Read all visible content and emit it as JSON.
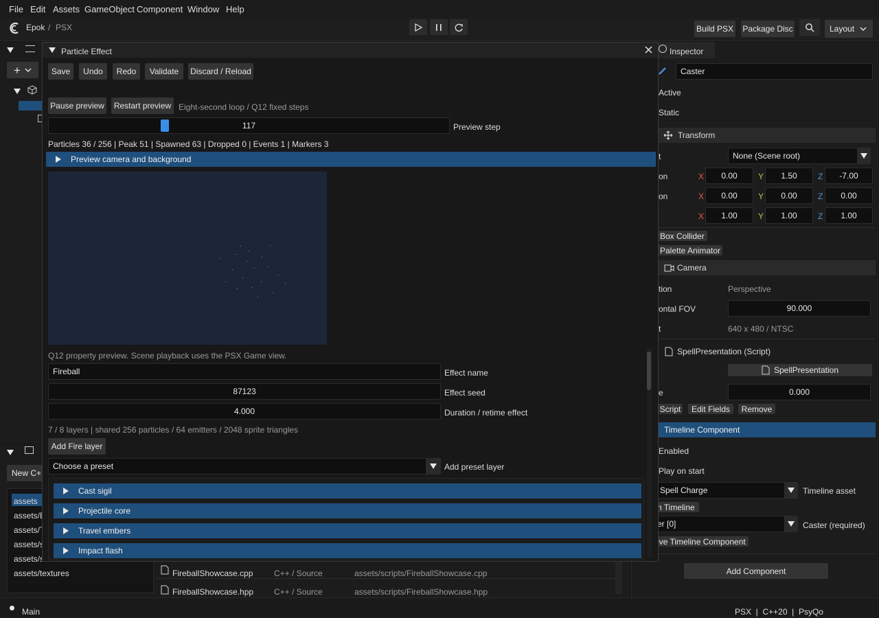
{
  "menu": [
    "File",
    "Edit",
    "Assets",
    "GameObject",
    "Component",
    "Window",
    "Help"
  ],
  "breadcrumb": {
    "project": "Epok",
    "separator": "/",
    "target": "PSX"
  },
  "toolbar": {
    "build": "Build PSX",
    "package": "Package Disc",
    "layout": "Layout"
  },
  "inspector": {
    "title": "Inspector",
    "object_name": "Caster",
    "active_label": "Active",
    "static_label": "Static",
    "transform": {
      "title": "Transform",
      "parent_row_label": "t",
      "parent_value": "None (Scene root)",
      "rows": [
        {
          "label": "on",
          "x": "0.00",
          "y": "1.50",
          "z": "-7.00"
        },
        {
          "label": "on",
          "x": "0.00",
          "y": "0.00",
          "z": "0.00"
        },
        {
          "label": "",
          "x": "1.00",
          "y": "1.00",
          "z": "1.00"
        }
      ],
      "axis_x": "X",
      "axis_y": "Y",
      "axis_z": "Z"
    },
    "box_collider": "Box Collider",
    "palette_animator": "Palette Animator",
    "camera": {
      "title": "Camera",
      "projection_label": "tion",
      "projection_value": "Perspective",
      "fov_label": "ontal FOV",
      "fov_value": "90.000",
      "res_label": "t",
      "res_value": "640 x 480 / NTSC"
    },
    "script": {
      "title": "SpellPresentation (Script)",
      "asset": "SpellPresentation",
      "value_label": "e",
      "value": "0.000",
      "btn_script": "Script",
      "btn_edit": "Edit Fields",
      "btn_remove": "Remove"
    },
    "timeline": {
      "title": "Timeline Component",
      "enabled": "Enabled",
      "play_on_start": "Play on start",
      "asset_value": "Spell Charge",
      "asset_label": "Timeline asset",
      "open_timeline": "n Timeline",
      "caster_value": "er [0]",
      "caster_label": "Caster (required)",
      "remove": "ove Timeline Component"
    },
    "add_component": "Add Component"
  },
  "left_panel": {
    "new_btn": "New C+",
    "folders": [
      "assets",
      "assets/E",
      "assets/T",
      "assets/s",
      "assets/s",
      "assets/textures"
    ],
    "files": [
      {
        "name": "FireballShowcase.cpp",
        "type": "C++ / Source",
        "path": "assets/scripts/FireballShowcase.cpp"
      },
      {
        "name": "FireballShowcase.hpp",
        "type": "C++ / Source",
        "path": "assets/scripts/FireballShowcase.hpp"
      }
    ]
  },
  "statusbar": {
    "left": "Main",
    "right": "PSX  |  C++20  |  PsyQo"
  },
  "dialog": {
    "title": "Particle Effect",
    "buttons": [
      "Save",
      "Undo",
      "Redo",
      "Validate",
      "Discard / Reload"
    ],
    "pause": "Pause preview",
    "restart": "Restart preview",
    "loop_info": "Eight-second loop / Q12 fixed steps",
    "preview_step": {
      "value": "117",
      "label": "Preview step",
      "fraction": 0.285
    },
    "stats": "Particles 36 / 256 | Peak 51 | Spawned 63 | Dropped 0 | Events 1 | Markers 3",
    "camera_section": "Preview camera and background",
    "preview_note": "Q12 property preview. Scene playback uses the PSX Game view.",
    "effect_name": {
      "value": "Fireball",
      "label": "Effect name"
    },
    "effect_seed": {
      "value": "87123",
      "label": "Effect seed"
    },
    "duration": {
      "value": "4.000",
      "label": "Duration / retime effect"
    },
    "layers_info": "7 / 8 layers | shared 256 particles / 64 emitters / 2048 sprite triangles",
    "add_fire": "Add Fire layer",
    "preset": {
      "value": "Choose a preset",
      "label": "Add preset layer"
    },
    "layers": [
      "Cast sigil",
      "Projectile core",
      "Travel embers",
      "Impact flash"
    ]
  }
}
